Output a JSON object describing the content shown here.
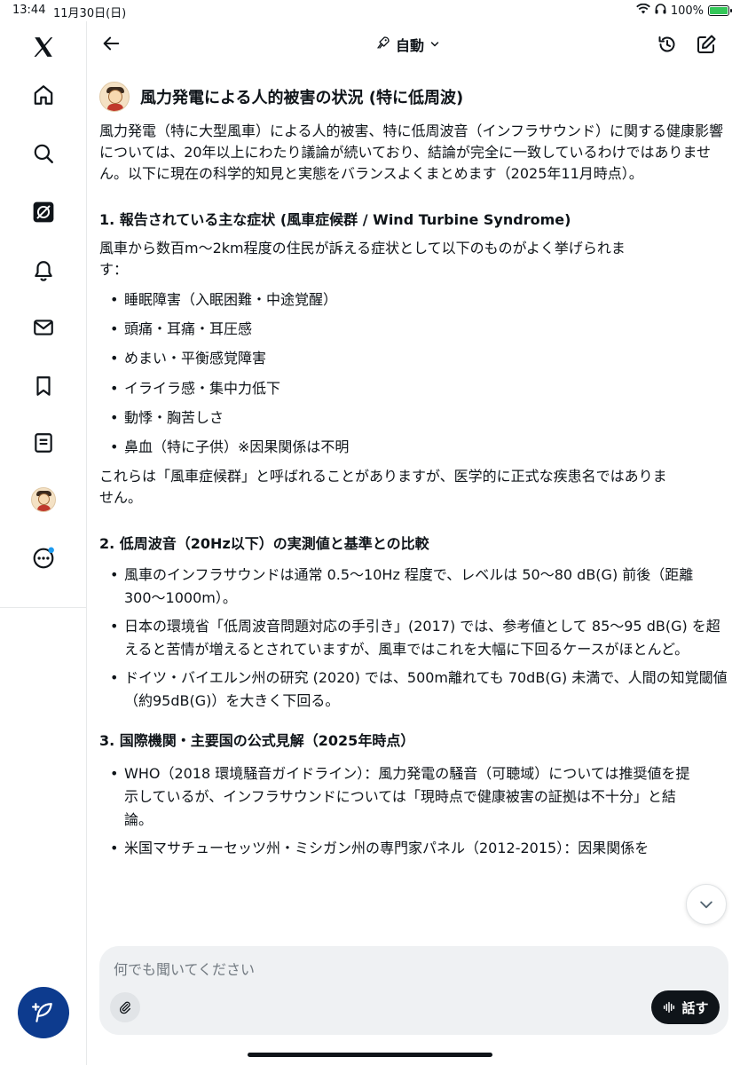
{
  "status_bar": {
    "time": "13:44",
    "date": "11月30日(日)",
    "battery": "100%"
  },
  "header": {
    "mode_label": "自動"
  },
  "message": {
    "title": "風力発電による人的被害の状況 (特に低周波)",
    "intro": "風力発電（特に大型風車）による人的被害、特に低周波音（インフラサウンド）に関する健康影響については、20年以上にわたり議論が続いており、結論が完全に一致しているわけではありません。以下に現在の科学的知見と実態をバランスよくまとめます（2025年11月時点）。",
    "section1": {
      "heading": "1. 報告されている主な症状 (風車症候群 / Wind Turbine Syndrome)",
      "paragraph": "風車から数百m〜2km程度の住民が訴える症状として以下のものがよく挙げられます：",
      "items": [
        "睡眠障害（入眠困難・中途覚醒）",
        "頭痛・耳痛・耳圧感",
        "めまい・平衡感覚障害",
        "イライラ感・集中力低下",
        "動悸・胸苦しさ",
        "鼻血（特に子供）※因果関係は不明"
      ],
      "closing": "これらは「風車症候群」と呼ばれることがありますが、医学的に正式な疾患名ではありません。"
    },
    "section2": {
      "heading": "2. 低周波音（20Hz以下）の実測値と基準との比較",
      "items": [
        "風車のインフラサウンドは通常 0.5〜10Hz 程度で、レベルは 50〜80 dB(G) 前後（距離300〜1000m）。",
        "日本の環境省「低周波音問題対応の手引き」(2017) では、参考値として 85〜95 dB(G) を超えると苦情が増えるとされていますが、風車ではこれを大幅に下回るケースがほとんど。",
        "ドイツ・バイエルン州の研究 (2020) では、500m離れても 70dB(G) 未満で、人間の知覚閾値（約95dB(G)）を大きく下回る。"
      ]
    },
    "section3": {
      "heading": "3. 国際機関・主要国の公式見解（2025年時点）",
      "items": [
        "WHO（2018 環境騒音ガイドライン）：風力発電の騒音（可聴域）については推奨値を提示しているが、インフラサウンドについては「現時点で健康被害の証拠は不十分」と結論。",
        "米国マサチューセッツ州・ミシガン州の専門家パネル（2012-2015）：因果関係を"
      ]
    }
  },
  "composer": {
    "placeholder": "何でも聞いてください",
    "speak_label": "話す"
  },
  "colors": {
    "text": "#0f1419",
    "compose_fab": "#0d3b8e",
    "composer_bg": "#eff1f3",
    "notification_dot": "#1d9bf0"
  }
}
